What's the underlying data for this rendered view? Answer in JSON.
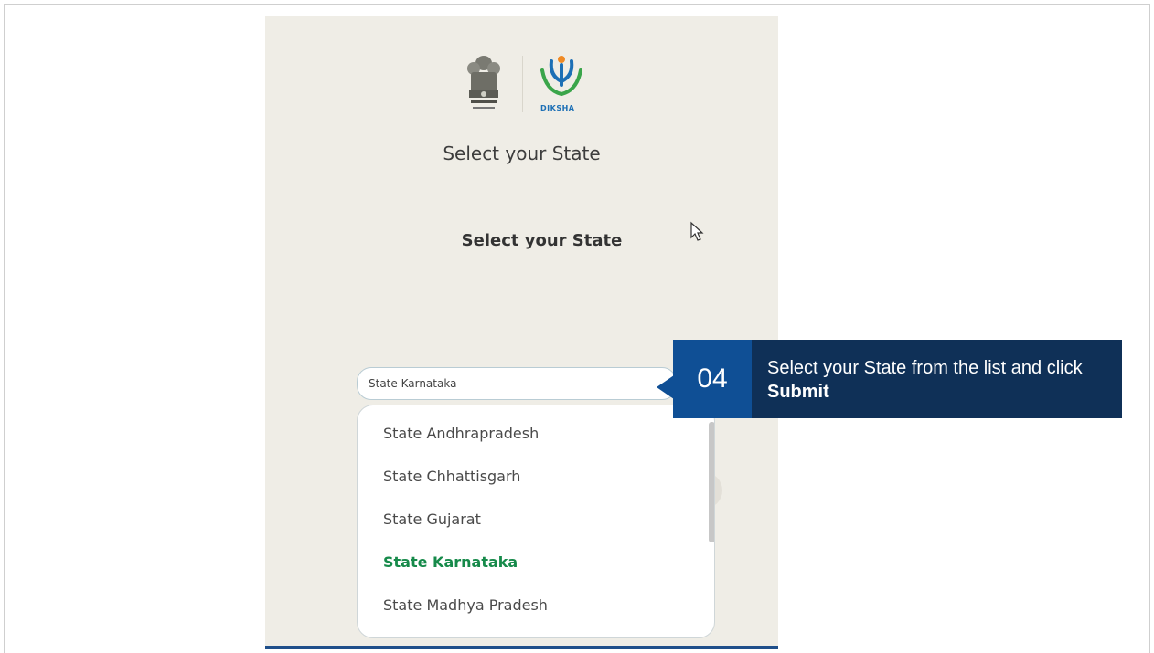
{
  "header": {
    "diksha_label": "DIKSHA",
    "title": "Select your State",
    "subtitle": "Select your State"
  },
  "select": {
    "value": "State Karnataka",
    "options": [
      "State Andhrapradesh",
      "State Chhattisgarh",
      "State Gujarat",
      "State Karnataka",
      "State Madhya Pradesh"
    ],
    "selected_index": 3
  },
  "callout": {
    "step": "04",
    "text_before": "Select your State from the list and click ",
    "text_bold": "Submit"
  },
  "colors": {
    "callout_bg": "#0f3057",
    "callout_step_bg": "#0f4f95",
    "selected_option": "#168a4a",
    "phone_bg": "#efede6"
  }
}
